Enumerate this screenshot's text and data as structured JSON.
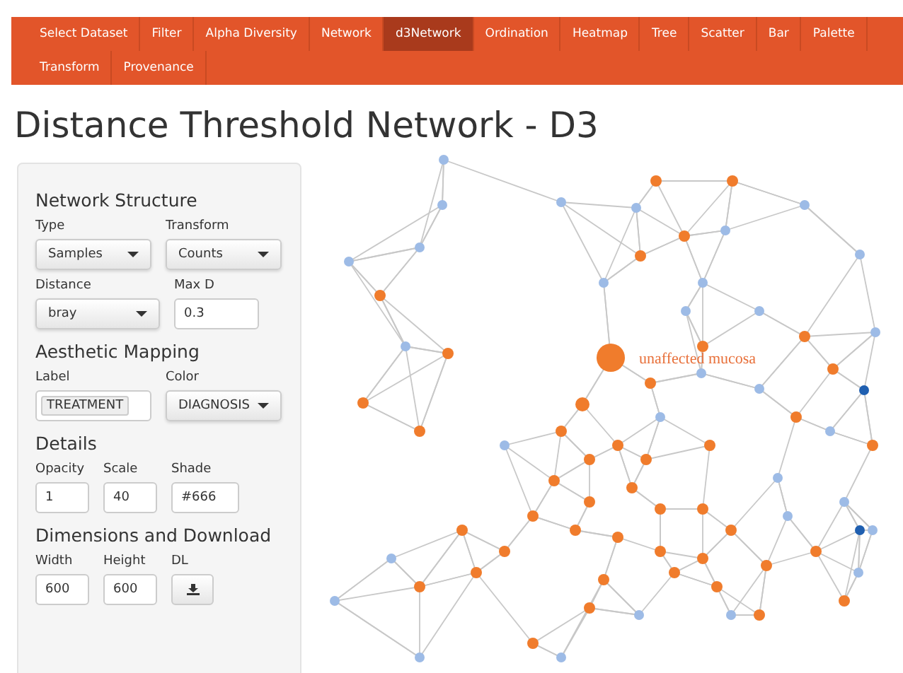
{
  "tabs": [
    {
      "label": "Select Dataset",
      "selected": false
    },
    {
      "label": "Filter",
      "selected": false
    },
    {
      "label": "Alpha Diversity",
      "selected": false
    },
    {
      "label": "Network",
      "selected": false
    },
    {
      "label": "d3Network",
      "selected": true
    },
    {
      "label": "Ordination",
      "selected": false
    },
    {
      "label": "Heatmap",
      "selected": false
    },
    {
      "label": "Tree",
      "selected": false
    },
    {
      "label": "Scatter",
      "selected": false
    },
    {
      "label": "Bar",
      "selected": false
    },
    {
      "label": "Palette",
      "selected": false
    },
    {
      "label": "Transform",
      "selected": false
    },
    {
      "label": "Provenance",
      "selected": false
    }
  ],
  "title": "Distance Threshold Network - D3",
  "sidebar": {
    "sections": [
      {
        "heading": "Network Structure",
        "rows": [
          [
            {
              "kind": "select",
              "label": "Type",
              "value": "Samples"
            },
            {
              "kind": "select",
              "label": "Transform",
              "value": "Counts"
            }
          ],
          [
            {
              "kind": "select",
              "label": "Distance",
              "value": "bray"
            },
            {
              "kind": "input",
              "label": "Max D",
              "value": "0.3"
            }
          ]
        ]
      },
      {
        "heading": "Aesthetic Mapping",
        "rows": [
          [
            {
              "kind": "tag",
              "label": "Label",
              "value": "TREATMENT"
            },
            {
              "kind": "select",
              "label": "Color",
              "value": "DIAGNOSIS"
            }
          ]
        ]
      },
      {
        "heading": "Details",
        "rows": [
          [
            {
              "kind": "input",
              "label": "Opacity",
              "value": "1"
            },
            {
              "kind": "input",
              "label": "Scale",
              "value": "40"
            },
            {
              "kind": "input",
              "label": "Shade",
              "value": "#666"
            }
          ]
        ]
      },
      {
        "heading": "Dimensions and Download",
        "rows": [
          [
            {
              "kind": "input",
              "label": "Width",
              "value": "600"
            },
            {
              "kind": "input",
              "label": "Height",
              "value": "600"
            },
            {
              "kind": "download",
              "label": "DL"
            }
          ]
        ]
      }
    ]
  },
  "network": {
    "node_label": "unaffected mucosa"
  }
}
